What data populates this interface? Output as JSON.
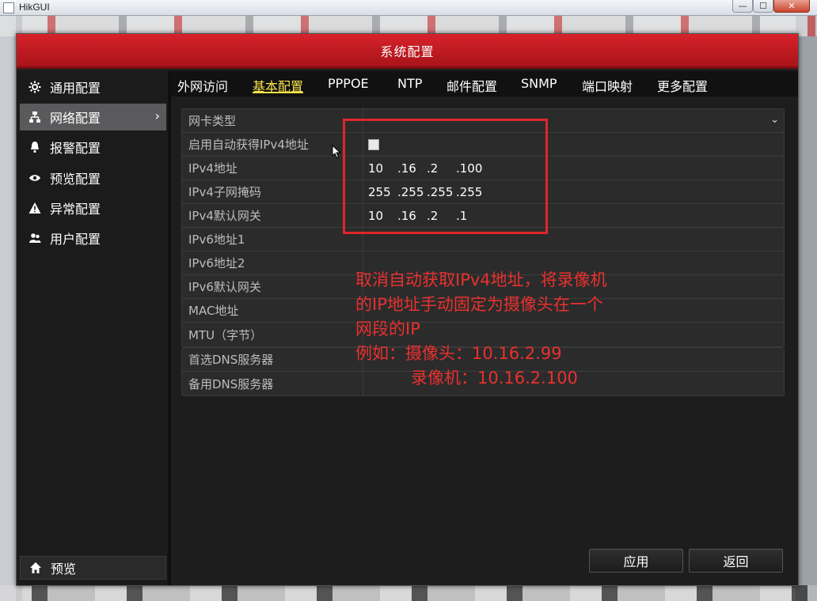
{
  "window": {
    "title": "HikGUI",
    "min_glyph": "—",
    "max_glyph": "☐",
    "close_glyph": "✕"
  },
  "dialog": {
    "title": "系统配置"
  },
  "sidebar": {
    "items": [
      {
        "label": "通用配置",
        "icon": "gear-icon"
      },
      {
        "label": "网络配置",
        "icon": "network-icon",
        "active": true
      },
      {
        "label": "报警配置",
        "icon": "alarm-bell-icon"
      },
      {
        "label": "预览配置",
        "icon": "eye-icon"
      },
      {
        "label": "异常配置",
        "icon": "warning-icon"
      },
      {
        "label": "用户配置",
        "icon": "users-icon"
      }
    ],
    "chevron": "›",
    "preview": {
      "label": "预览",
      "icon": "home-icon"
    }
  },
  "tabs": [
    {
      "label": "外网访问"
    },
    {
      "label": "基本配置",
      "active": true
    },
    {
      "label": "PPPOE"
    },
    {
      "label": "NTP"
    },
    {
      "label": "邮件配置"
    },
    {
      "label": "SNMP"
    },
    {
      "label": "端口映射"
    },
    {
      "label": "更多配置"
    }
  ],
  "form": {
    "nic_type": {
      "label": "网卡类型",
      "value": ""
    },
    "dhcp": {
      "label": "启用自动获得IPv4地址",
      "checked": false
    },
    "ipv4_address": {
      "label": "IPv4地址",
      "octets": [
        "10",
        ".16",
        ".2",
        ".100"
      ]
    },
    "ipv4_mask": {
      "label": "IPv4子网掩码",
      "octets": [
        "255",
        ".255",
        ".255",
        ".255"
      ]
    },
    "ipv4_gateway": {
      "label": "IPv4默认网关",
      "octets": [
        "10",
        ".16",
        ".2",
        ".1"
      ]
    },
    "ipv6_address1": {
      "label": "IPv6地址1",
      "value": ""
    },
    "ipv6_address2": {
      "label": "IPv6地址2",
      "value": ""
    },
    "ipv6_gateway": {
      "label": "IPv6默认网关",
      "value": ""
    },
    "mac": {
      "label": "MAC地址",
      "value": ""
    },
    "mtu": {
      "label": "MTU（字节）",
      "value": ""
    },
    "dns_primary": {
      "label": "首选DNS服务器",
      "value": ""
    },
    "dns_secondary": {
      "label": "备用DNS服务器",
      "value": ""
    },
    "dropdown_glyph": "⌄"
  },
  "annotation": {
    "line1": "取消自动获取IPv4地址，将录像机",
    "line2": "的IP地址手动固定为摄像头在一个",
    "line3": "网段的IP",
    "line4": "例如：摄像头：10.16.2.99",
    "line5": "录像机：10.16.2.100",
    "color": "#e8312f"
  },
  "buttons": {
    "apply": "应用",
    "back": "返回"
  },
  "colors": {
    "header_red": "#c51c23",
    "active_tab": "#f5e04a"
  }
}
